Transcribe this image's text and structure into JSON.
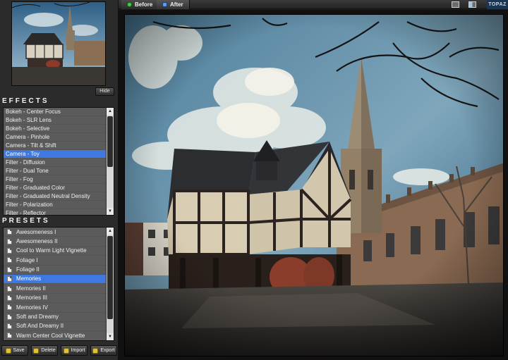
{
  "sidebar": {
    "hide_label": "Hide",
    "effects_title": "EFFECTS",
    "presets_title": "PRESETS",
    "effects": [
      "Bokeh - Center Focus",
      "Bokeh - SLR Lens",
      "Bokeh - Selective",
      "Camera - Pinhole",
      "Camera - Tilt & Shift",
      "Camera - Toy",
      "Filter - Diffusion",
      "Filter - Dual Tone",
      "Filter - Fog",
      "Filter - Graduated Color",
      "Filter - Graduated Neutral Density",
      "Filter - Polarization",
      "Filter - Reflector"
    ],
    "selected_effect": "Camera - Toy",
    "presets": [
      "Awesomeness I",
      "Awesomeness II",
      "Cool to Warm Light Vignette",
      "Foliage I",
      "Foliage II",
      "Memories",
      "Memories II",
      "Memories III",
      "Memories IV",
      "Soft and Dreamy",
      "Soft And Dreamy II",
      "Warm Center Cool Vignette"
    ],
    "selected_preset": "Memories",
    "buttons": {
      "save": "Save",
      "delete": "Delete",
      "import": "Import",
      "export": "Export"
    }
  },
  "toolbar": {
    "before_label": "Before",
    "after_label": "After",
    "logo_text": "TOPAZ"
  },
  "colors": {
    "selection": "#3f79e0",
    "panel": "#2b2b2b",
    "list_bg": "#5b5b5b"
  },
  "icons": {
    "before": "green-dot-icon",
    "after": "blue-dot-icon",
    "preset_item": "document-icon",
    "single_view": "single-view-icon",
    "split_view": "split-view-icon"
  }
}
